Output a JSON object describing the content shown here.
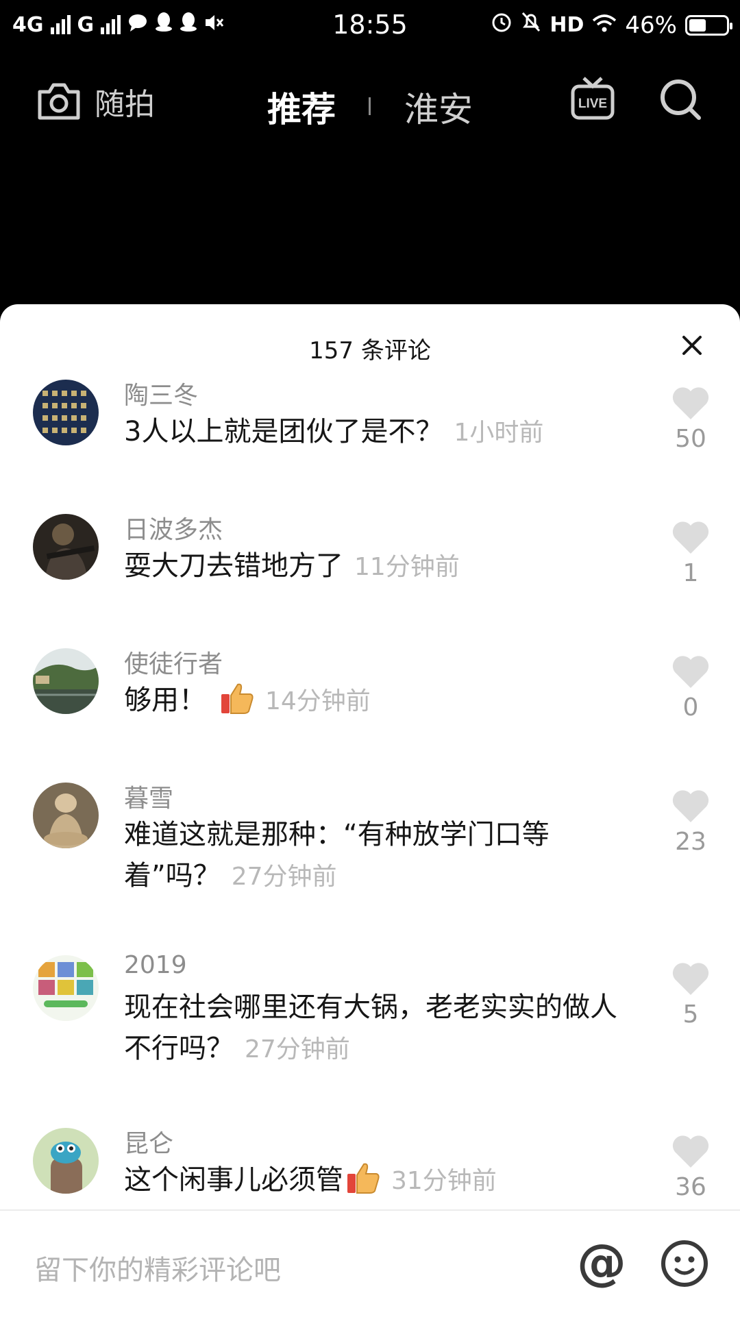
{
  "status_bar": {
    "network1": "4G",
    "network2": "G",
    "time": "18:55",
    "hd": "HD",
    "battery": "46%",
    "battery_level": 0.46
  },
  "top_nav": {
    "camera_label": "随拍",
    "tabs": [
      {
        "label": "推荐",
        "active": true
      },
      {
        "label": "淮安",
        "active": false
      }
    ],
    "live_icon_text": "LIVE"
  },
  "sheet": {
    "title": "157 条评论"
  },
  "comments": [
    {
      "user": "陶三冬",
      "text": "3人以上就是团伙了是不？",
      "time": "1小时前",
      "likes": "50",
      "avatar": "calligraphy-avatar",
      "thumb": false
    },
    {
      "user": "日波多杰",
      "text": "耍大刀去错地方了",
      "time": "11分钟前",
      "likes": "1",
      "avatar": "warrior-avatar",
      "thumb": false
    },
    {
      "user": "使徒行者",
      "text": "够用！",
      "time": "14分钟前",
      "likes": "0",
      "avatar": "landscape-avatar",
      "thumb": true
    },
    {
      "user": "暮雪",
      "text": "难道这就是那种：“有种放学门口等着”吗？",
      "time": "27分钟前",
      "likes": "23",
      "avatar": "meditating-dog-avatar",
      "thumb": false
    },
    {
      "user": "2019",
      "text": "现在社会哪里还有大锅，老老实实的做人不行吗？",
      "time": "27分钟前",
      "likes": "5",
      "avatar": "game-collage-avatar",
      "thumb": false
    },
    {
      "user": "昆仑",
      "text": "这个闲事儿必须管",
      "time": "31分钟前",
      "likes": "36",
      "avatar": "cartoon-avatar",
      "thumb": true
    }
  ],
  "input_bar": {
    "placeholder": "留下你的精彩评论吧",
    "at_label": "@"
  },
  "colors": {
    "sheet_bg": "#ffffff",
    "like_gray": "#dcdcdc",
    "username_gray": "#8d8d8d",
    "time_gray": "#b8b8b8"
  }
}
